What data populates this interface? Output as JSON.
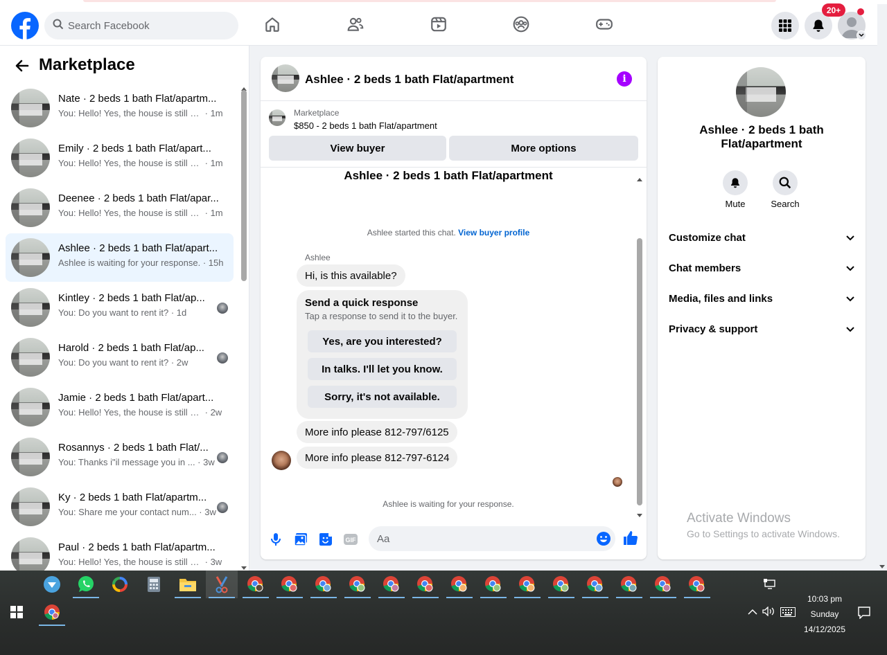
{
  "header": {
    "search_placeholder": "Search Facebook",
    "notification_badge": "20+"
  },
  "sidebar": {
    "title": "Marketplace",
    "conversations": [
      {
        "name": "Nate · 2 beds 1 bath Flat/apartm...",
        "preview": "You: Hello! Yes, the house is still av...",
        "time": "1m"
      },
      {
        "name": "Emily · 2 beds 1 bath Flat/apart...",
        "preview": "You: Hello! Yes, the house is still av...",
        "time": "1m"
      },
      {
        "name": "Deenee · 2 beds 1 bath Flat/apar...",
        "preview": "You: Hello! Yes, the house is still av...",
        "time": "1m"
      },
      {
        "name": "Ashlee · 2 beds 1 bath Flat/apart...",
        "preview": "Ashlee is waiting for your response.",
        "time": "15h"
      },
      {
        "name": "Kintley · 2 beds 1 bath Flat/ap...",
        "preview": "You: Do you want to rent it?",
        "time": "1d"
      },
      {
        "name": "Harold · 2 beds 1 bath Flat/ap...",
        "preview": "You: Do you want to rent it?",
        "time": "2w"
      },
      {
        "name": "Jamie · 2 beds 1 bath Flat/apart...",
        "preview": "You: Hello! Yes, the house is still av...",
        "time": "2w"
      },
      {
        "name": "Rosannys · 2 beds 1 bath Flat/...",
        "preview": "You: Thanks i\"il message you in ...",
        "time": "3w"
      },
      {
        "name": "Ky · 2 beds 1 bath Flat/apartm...",
        "preview": "You: Share me your contact num...",
        "time": "3w"
      },
      {
        "name": "Paul · 2 beds 1 bath Flat/apartm...",
        "preview": "You: Hello! Yes, the house is still av...",
        "time": "3w"
      }
    ]
  },
  "chat": {
    "title": "Ashlee · 2 beds 1 bath Flat/apartment",
    "listing_source": "Marketplace",
    "listing_price": "$850 - 2 beds 1 bath Flat/apartment",
    "view_buyer": "View buyer",
    "more_options": "More options",
    "conversation_title": "Ashlee · 2 beds 1 bath Flat/apartment",
    "started_text": "Ashlee started this chat.",
    "view_buyer_profile": "View buyer profile",
    "sender_name": "Ashlee",
    "first_message": "Hi, is this available?",
    "quick_title": "Send a quick response",
    "quick_subtitle": "Tap a response to send it to the buyer.",
    "quick_options": [
      "Yes, are you interested?",
      "In talks. I'll let you know.",
      "Sorry, it's not available."
    ],
    "message_2": "More info please 812-797/6125",
    "message_3": "More info please 812-797-6124",
    "waiting_text": "Ashlee is waiting for your response.",
    "input_placeholder": "Aa"
  },
  "right_panel": {
    "name": "Ashlee · 2 beds 1 bath Flat/apartment",
    "mute": "Mute",
    "search": "Search",
    "rows": [
      "Customize chat",
      "Chat members",
      "Media, files and links",
      "Privacy & support"
    ],
    "activate_title": "Activate Windows",
    "activate_sub": "Go to Settings to activate Windows."
  },
  "taskbar": {
    "time": "10:03 pm",
    "day": "Sunday",
    "date": "14/12/2025"
  },
  "colors": {
    "brand": "#0866ff",
    "messenger_purple": "#a500ff",
    "badge_red": "#e41e3f",
    "link_blue": "#0064d1"
  }
}
